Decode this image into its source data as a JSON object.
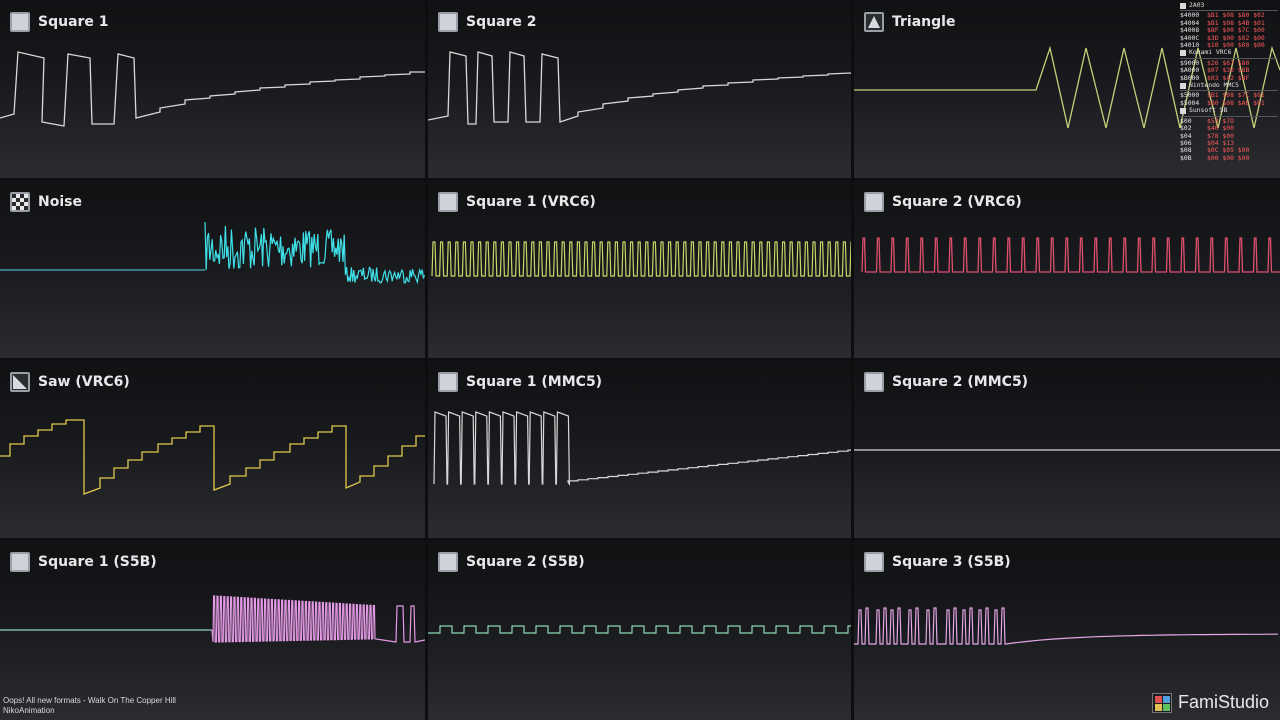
{
  "panels": [
    {
      "title": "Square 1",
      "icon": "square-wave-icon",
      "color": "#d8d8d8"
    },
    {
      "title": "Square 2",
      "icon": "square-wave-icon",
      "color": "#d8d8d8"
    },
    {
      "title": "Triangle",
      "icon": "triangle-wave-icon",
      "color": "#c7d07a"
    },
    {
      "title": "Noise",
      "icon": "noise-icon",
      "color": "#3fe0e8"
    },
    {
      "title": "Square 1 (VRC6)",
      "icon": "square-wave-icon",
      "color": "#c9d66a"
    },
    {
      "title": "Square 2 (VRC6)",
      "icon": "square-wave-icon",
      "color": "#e0506e"
    },
    {
      "title": "Saw (VRC6)",
      "icon": "saw-wave-icon",
      "color": "#e0c84a"
    },
    {
      "title": "Square 1 (MMC5)",
      "icon": "square-wave-icon",
      "color": "#d8d8d8"
    },
    {
      "title": "Square 2 (MMC5)",
      "icon": "square-wave-icon",
      "color": "#d8d8d8"
    },
    {
      "title": "Square 1 (S5B)",
      "icon": "square-wave-icon",
      "color": "#e49ae6"
    },
    {
      "title": "Square 2 (S5B)",
      "icon": "square-wave-icon",
      "color": "#8fd8b8"
    },
    {
      "title": "Square 3 (S5B)",
      "icon": "square-wave-icon",
      "color": "#e4a6e6"
    }
  ],
  "registers": [
    {
      "chip": "2A03",
      "rows": [
        {
          "addr": "$4000",
          "vals": "$B1 $08 $80 $02"
        },
        {
          "addr": "$4004",
          "vals": "$B1 $08 $4B $01"
        },
        {
          "addr": "$4008",
          "vals": "$8F $00 $7C $00"
        },
        {
          "addr": "$400C",
          "vals": "$3D $00 $02 $00"
        },
        {
          "addr": "$4010",
          "vals": "$10 $00 $00 $00"
        }
      ]
    },
    {
      "chip": "Konami VRC6",
      "rows": [
        {
          "addr": "$9000",
          "vals": "$26 $67 $80"
        },
        {
          "addr": "$A000",
          "vals": "$07 $3D $8B"
        },
        {
          "addr": "$B000",
          "vals": "$03 $42 $8F"
        }
      ]
    },
    {
      "chip": "Nintendo MMC5",
      "rows": [
        {
          "addr": "$5000",
          "vals": "$B1 $08 $7C $01"
        },
        {
          "addr": "$5004",
          "vals": "$B0 $08 $AE $01"
        }
      ]
    },
    {
      "chip": "Sunsoft 5B",
      "rows": [
        {
          "addr": "$00",
          "vals": "$53 $7D"
        },
        {
          "addr": "$02",
          "vals": "$40 $00"
        },
        {
          "addr": "$04",
          "vals": "$78 $00"
        },
        {
          "addr": "$06",
          "vals": "$04 $13"
        },
        {
          "addr": "$08",
          "vals": "$0C $05 $00"
        },
        {
          "addr": "$0B",
          "vals": "$00 $00 $00"
        }
      ]
    }
  ],
  "credits": {
    "line1": "Oops! All new formats - Walk On The Copper Hill",
    "line2": "NikoAnimation"
  },
  "brand": {
    "name": "FamiStudio"
  }
}
